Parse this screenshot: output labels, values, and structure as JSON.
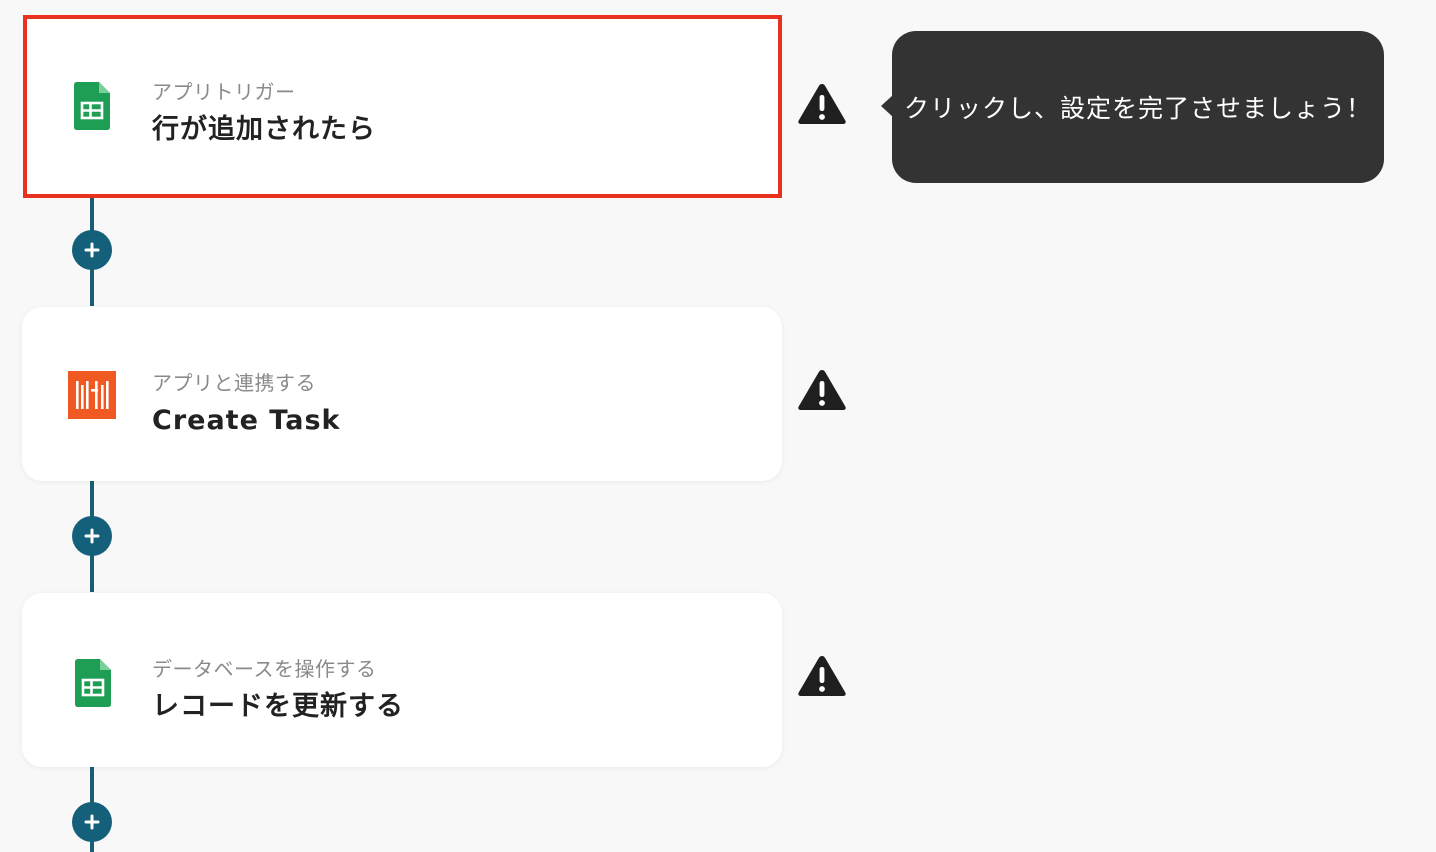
{
  "steps": [
    {
      "app_icon": "google-sheets-icon",
      "subtitle": "アプリトリガー",
      "title": "行が追加されたら",
      "selected": true,
      "warning_icon": "warning-icon"
    },
    {
      "app_icon": "orange-task-app-icon",
      "subtitle": "アプリと連携する",
      "title": "Create Task",
      "selected": false,
      "warning_icon": "warning-icon"
    },
    {
      "app_icon": "google-sheets-icon",
      "subtitle": "データベースを操作する",
      "title": "レコードを更新する",
      "selected": false,
      "warning_icon": "warning-icon"
    }
  ],
  "tooltip": {
    "text": "クリックし、設定を完了させましょう！"
  },
  "add_buttons": [
    {
      "icon": "plus-icon"
    },
    {
      "icon": "plus-icon"
    },
    {
      "icon": "plus-icon"
    }
  ],
  "colors": {
    "selected_border": "#e8311f",
    "connector": "#1b5e74",
    "add_button": "#14607a",
    "tooltip_bg": "#333333",
    "sheets_green": "#1e9e55",
    "task_orange": "#f05a22"
  }
}
